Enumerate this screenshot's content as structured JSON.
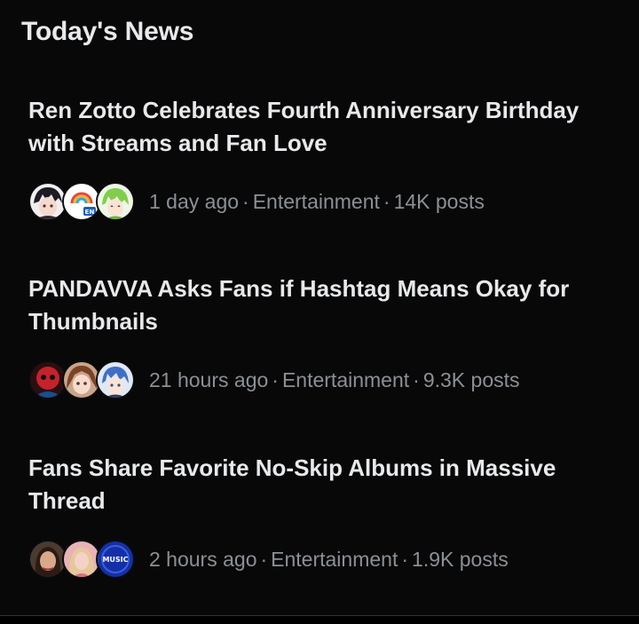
{
  "section": {
    "title": "Today's News"
  },
  "news": [
    {
      "headline": "Ren Zotto Celebrates Fourth Anniversary Birthday with Streams and Fan Love",
      "time": "1 day ago",
      "category": "Entertainment",
      "posts": "14K posts",
      "avatars": [
        "anime-boy-dark-hair-avatar",
        "en-rainbow-logo-avatar",
        "green-hair-anime-avatar"
      ]
    },
    {
      "headline": "PANDAVVA Asks Fans if Hashtag Means Okay for Thumbnails",
      "time": "21 hours ago",
      "category": "Entertainment",
      "posts": "9.3K posts",
      "avatars": [
        "red-character-avatar",
        "brown-hair-anime-avatar",
        "blue-hair-anime-avatar"
      ]
    },
    {
      "headline": "Fans Share Favorite No-Skip Albums in Massive Thread",
      "time": "2 hours ago",
      "category": "Entertainment",
      "posts": "1.9K posts",
      "avatars": [
        "woman-photo-avatar",
        "pink-photo-avatar",
        "music-logo-avatar"
      ]
    }
  ],
  "separator": "·",
  "colors": {
    "background": "#000000",
    "card": "#080808",
    "text": "#e7e9ea",
    "muted": "#8b9096",
    "divider": "#2f3336"
  }
}
